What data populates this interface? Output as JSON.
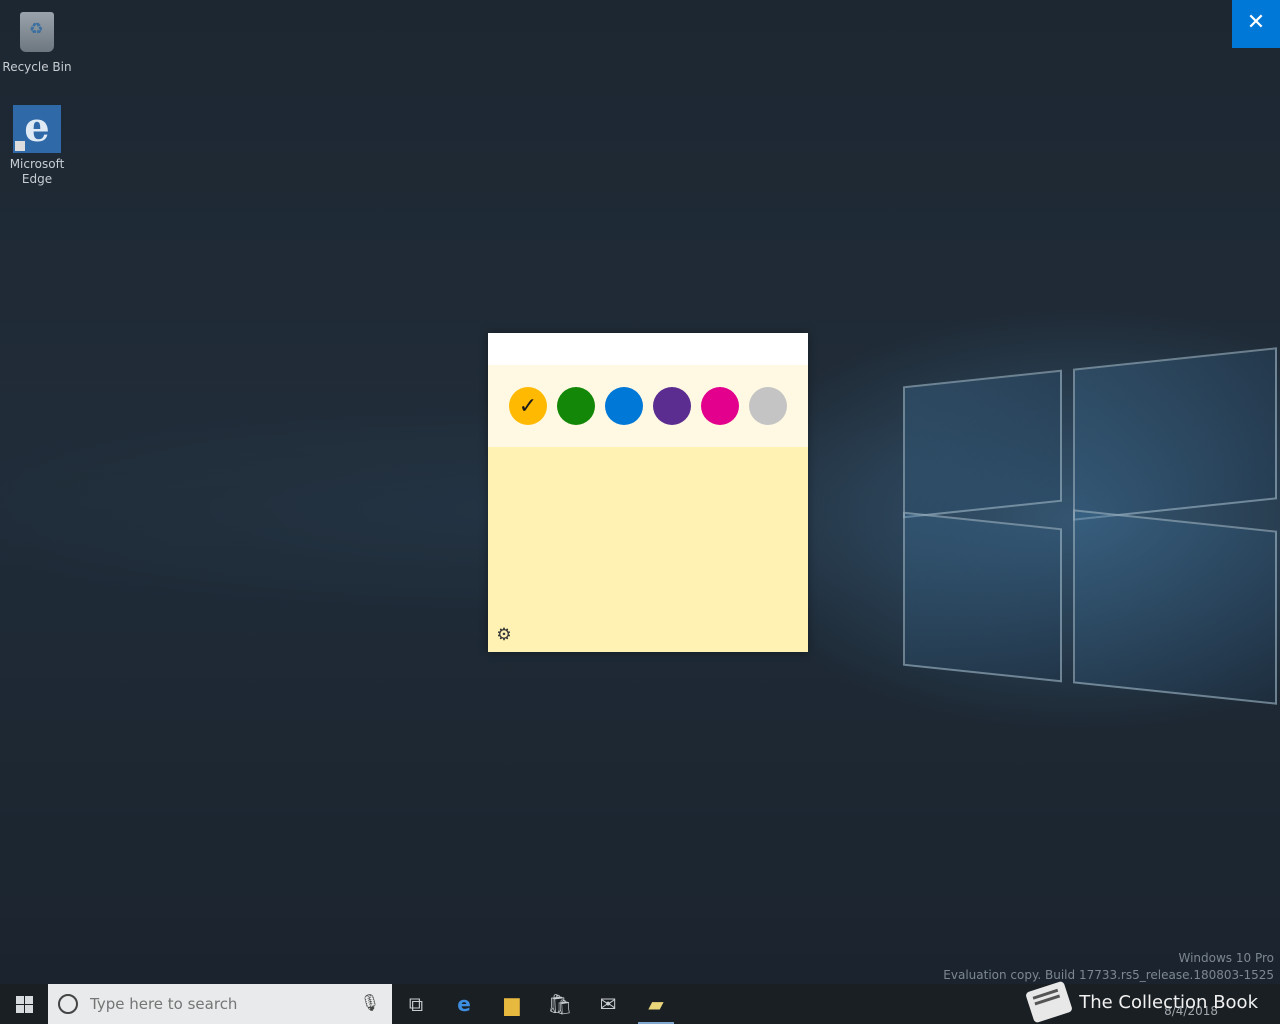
{
  "desktop": {
    "icons": [
      {
        "label": "Recycle Bin",
        "icon": "recycle-bin-icon"
      },
      {
        "label": "Microsoft Edge",
        "icon": "edge-icon"
      }
    ]
  },
  "overlay": {
    "close_glyph": "✕"
  },
  "sticky_note": {
    "colors": [
      {
        "name": "Yellow",
        "hex": "#ffb900",
        "selected": true
      },
      {
        "name": "Green",
        "hex": "#138808"
      },
      {
        "name": "Blue",
        "hex": "#0078d7"
      },
      {
        "name": "Purple",
        "hex": "#5c2d91"
      },
      {
        "name": "Pink",
        "hex": "#e3008c"
      },
      {
        "name": "Gray",
        "hex": "#c4c4c4"
      }
    ],
    "check_glyph": "✓",
    "settings_glyph": "⚙"
  },
  "watermark": {
    "line1": "Windows 10 Pro",
    "line2": "Evaluation copy. Build 17733.rs5_release.180803-1525"
  },
  "taskbar": {
    "search_placeholder": "Type here to search",
    "clock_date": "8/4/2018"
  },
  "brand_overlay": {
    "text": "The Collection Book"
  }
}
